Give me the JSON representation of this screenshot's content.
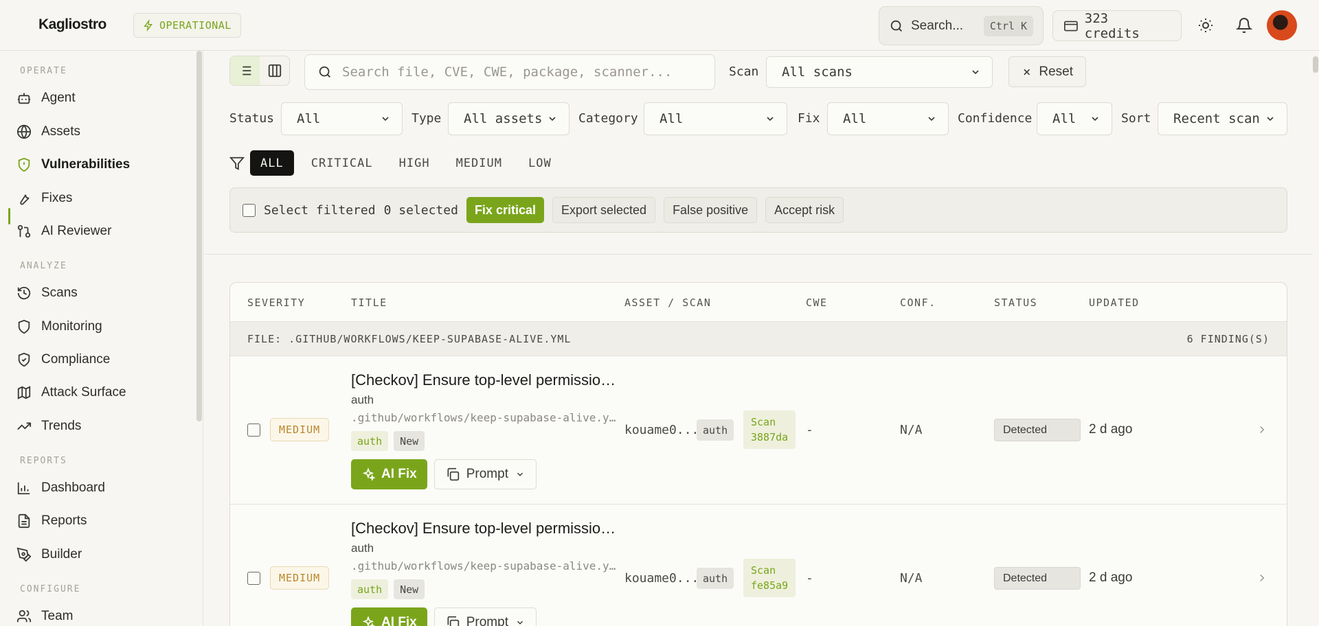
{
  "topbar": {
    "logo": "Kagliostro",
    "status": "OPERATIONAL",
    "search_label": "Search...",
    "search_shortcut": "Ctrl K",
    "credits": "323 credits",
    "icons": [
      "sun-icon",
      "bell-icon"
    ]
  },
  "sidebar": {
    "sections": [
      {
        "title": "OPERATE",
        "items": [
          {
            "label": "Agent",
            "icon": "robot-icon"
          },
          {
            "label": "Assets",
            "icon": "globe-icon"
          },
          {
            "label": "Vulnerabilities",
            "icon": "shield-alert-icon",
            "active": true
          },
          {
            "label": "Fixes",
            "icon": "wrench-icon"
          },
          {
            "label": "AI Reviewer",
            "icon": "git-compare-icon"
          }
        ]
      },
      {
        "title": "ANALYZE",
        "items": [
          {
            "label": "Scans",
            "icon": "history-icon"
          },
          {
            "label": "Monitoring",
            "icon": "shield-icon"
          },
          {
            "label": "Compliance",
            "icon": "shield-check-icon"
          },
          {
            "label": "Attack Surface",
            "icon": "map-icon"
          },
          {
            "label": "Trends",
            "icon": "trending-up-icon"
          }
        ]
      },
      {
        "title": "REPORTS",
        "items": [
          {
            "label": "Dashboard",
            "icon": "bar-chart-icon"
          },
          {
            "label": "Reports",
            "icon": "file-text-icon"
          },
          {
            "label": "Builder",
            "icon": "pen-tool-icon"
          }
        ]
      },
      {
        "title": "CONFIGURE",
        "items": [
          {
            "label": "Team",
            "icon": "users-icon"
          }
        ]
      }
    ]
  },
  "filters": {
    "search_placeholder": "Search file, CVE, CWE, package, scanner...",
    "scan_label": "Scan",
    "scan_value": "All scans",
    "reset_label": "Reset",
    "status_label": "Status",
    "status_value": "All",
    "type_label": "Type",
    "type_value": "All assets",
    "category_label": "Category",
    "category_value": "All",
    "fix_label": "Fix",
    "fix_value": "All",
    "confidence_label": "Confidence",
    "confidence_value": "All",
    "sort_label": "Sort",
    "sort_value": "Recent scan",
    "severity_tabs": [
      "ALL",
      "CRITICAL",
      "HIGH",
      "MEDIUM",
      "LOW"
    ],
    "active_tab": "ALL"
  },
  "bulk": {
    "select_label": "Select filtered",
    "selected_count": "0 selected",
    "fix_critical": "Fix critical",
    "export_selected": "Export selected",
    "false_positive": "False positive",
    "accept_risk": "Accept risk"
  },
  "table": {
    "columns": [
      "SEVERITY",
      "TITLE",
      "ASSET / SCAN",
      "CWE",
      "CONF.",
      "STATUS",
      "UPDATED"
    ],
    "group": {
      "file": "FILE: .GITHUB/WORKFLOWS/KEEP-SUPABASE-ALIVE.YML",
      "count": "6 FINDING(S)"
    },
    "rows": [
      {
        "severity": "MEDIUM",
        "title": "[Checkov] Ensure top-level permissions are not set to write-all",
        "subtitle": "auth",
        "path": ".github/workflows/keep-supabase-alive.yml",
        "tags": [
          "auth",
          "New"
        ],
        "ai_fix": "AI Fix",
        "prompt": "Prompt",
        "asset": "kouame0...",
        "asset_tag": "auth",
        "scan_label": "Scan",
        "scan_id": "3887da",
        "cwe": "-",
        "conf": "N/A",
        "status": "Detected",
        "updated": "2 d ago"
      },
      {
        "severity": "MEDIUM",
        "title": "[Checkov] Ensure top-level permissions are not set to write-all",
        "subtitle": "auth",
        "path": ".github/workflows/keep-supabase-alive.yml",
        "tags": [
          "auth",
          "New"
        ],
        "ai_fix": "AI Fix",
        "prompt": "Prompt",
        "asset": "kouame0...",
        "asset_tag": "auth",
        "scan_label": "Scan",
        "scan_id": "fe85a9",
        "cwe": "-",
        "conf": "N/A",
        "status": "Detected",
        "updated": "2 d ago"
      }
    ]
  }
}
